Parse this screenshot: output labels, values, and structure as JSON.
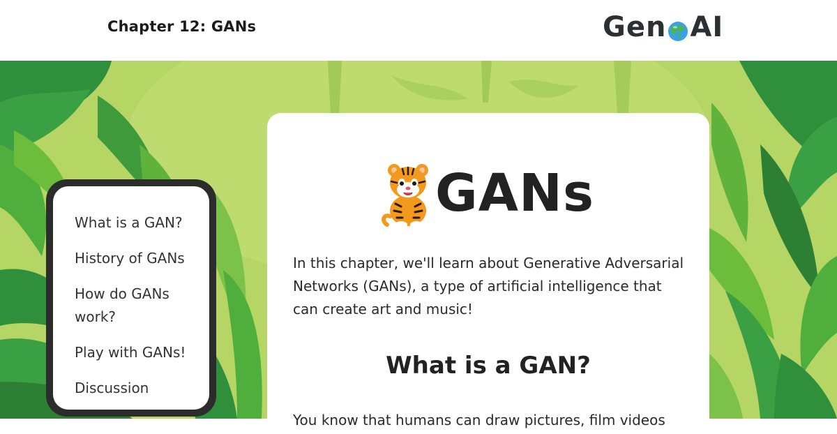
{
  "header": {
    "chapter_title": "Chapter 12: GANs",
    "logo_text_left": "Gen",
    "logo_text_right": "AI"
  },
  "sidebar": {
    "items": [
      {
        "label": "What is a GAN?"
      },
      {
        "label": "History of GANs"
      },
      {
        "label": "How do GANs work?"
      },
      {
        "label": "Play with GANs!"
      },
      {
        "label": "Discussion"
      }
    ]
  },
  "main": {
    "heading": "GANs",
    "intro": "In this chapter, we'll learn about Generative Adversarial Networks (GANs), a type of artificial intelligence that can create art and music!",
    "section_heading": "What is a GAN?",
    "section_text": "You know that humans can draw pictures, film videos"
  },
  "colors": {
    "jungle_background": "#a8cf5a",
    "nav_border": "#2c2c2c",
    "text_dark": "#222222"
  },
  "icons": {
    "logo_globe": "globe-icon",
    "mascot": "tiger-icon"
  }
}
